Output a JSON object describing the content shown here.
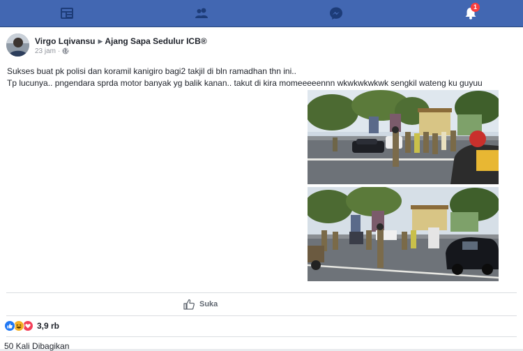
{
  "nav": {
    "items": [
      {
        "name": "news-feed",
        "icon": "news-feed-icon"
      },
      {
        "name": "friends",
        "icon": "friends-icon"
      },
      {
        "name": "messenger",
        "icon": "messenger-icon"
      },
      {
        "name": "notifications",
        "icon": "bell-icon",
        "badge": "1"
      }
    ],
    "colors": {
      "bar": "#4267b2",
      "icons": "#1d3c78",
      "badge": "#fa3e3e"
    }
  },
  "post": {
    "author": "Virgo Lqivansu",
    "group": "Ajang Sapa Sedulur ICB®",
    "time": "23 jam",
    "separator": "·",
    "text_lines": [
      "Sukses buat pk polisi dan koramil kanigiro bagi2 takjil di bln ramadhan thn ini..",
      "Tp lucunya.. pngendara sprda motor banyak yg balik kanan.. takut di kira momeeeeennn wkwkwkwkwk sengkil wateng ku guyuu"
    ],
    "photos": [
      {
        "icon": "street-scene-photo"
      },
      {
        "icon": "street-scene-photo"
      }
    ]
  },
  "actions": {
    "like_label": "Suka"
  },
  "reactions": {
    "count": "3,9 rb",
    "types": [
      "like-icon",
      "haha-icon",
      "love-icon"
    ],
    "colors": {
      "like": "#2078f4",
      "haha": "#f7b125",
      "love": "#f33e58"
    }
  },
  "shares": {
    "label": "50 Kali Dibagikan"
  }
}
